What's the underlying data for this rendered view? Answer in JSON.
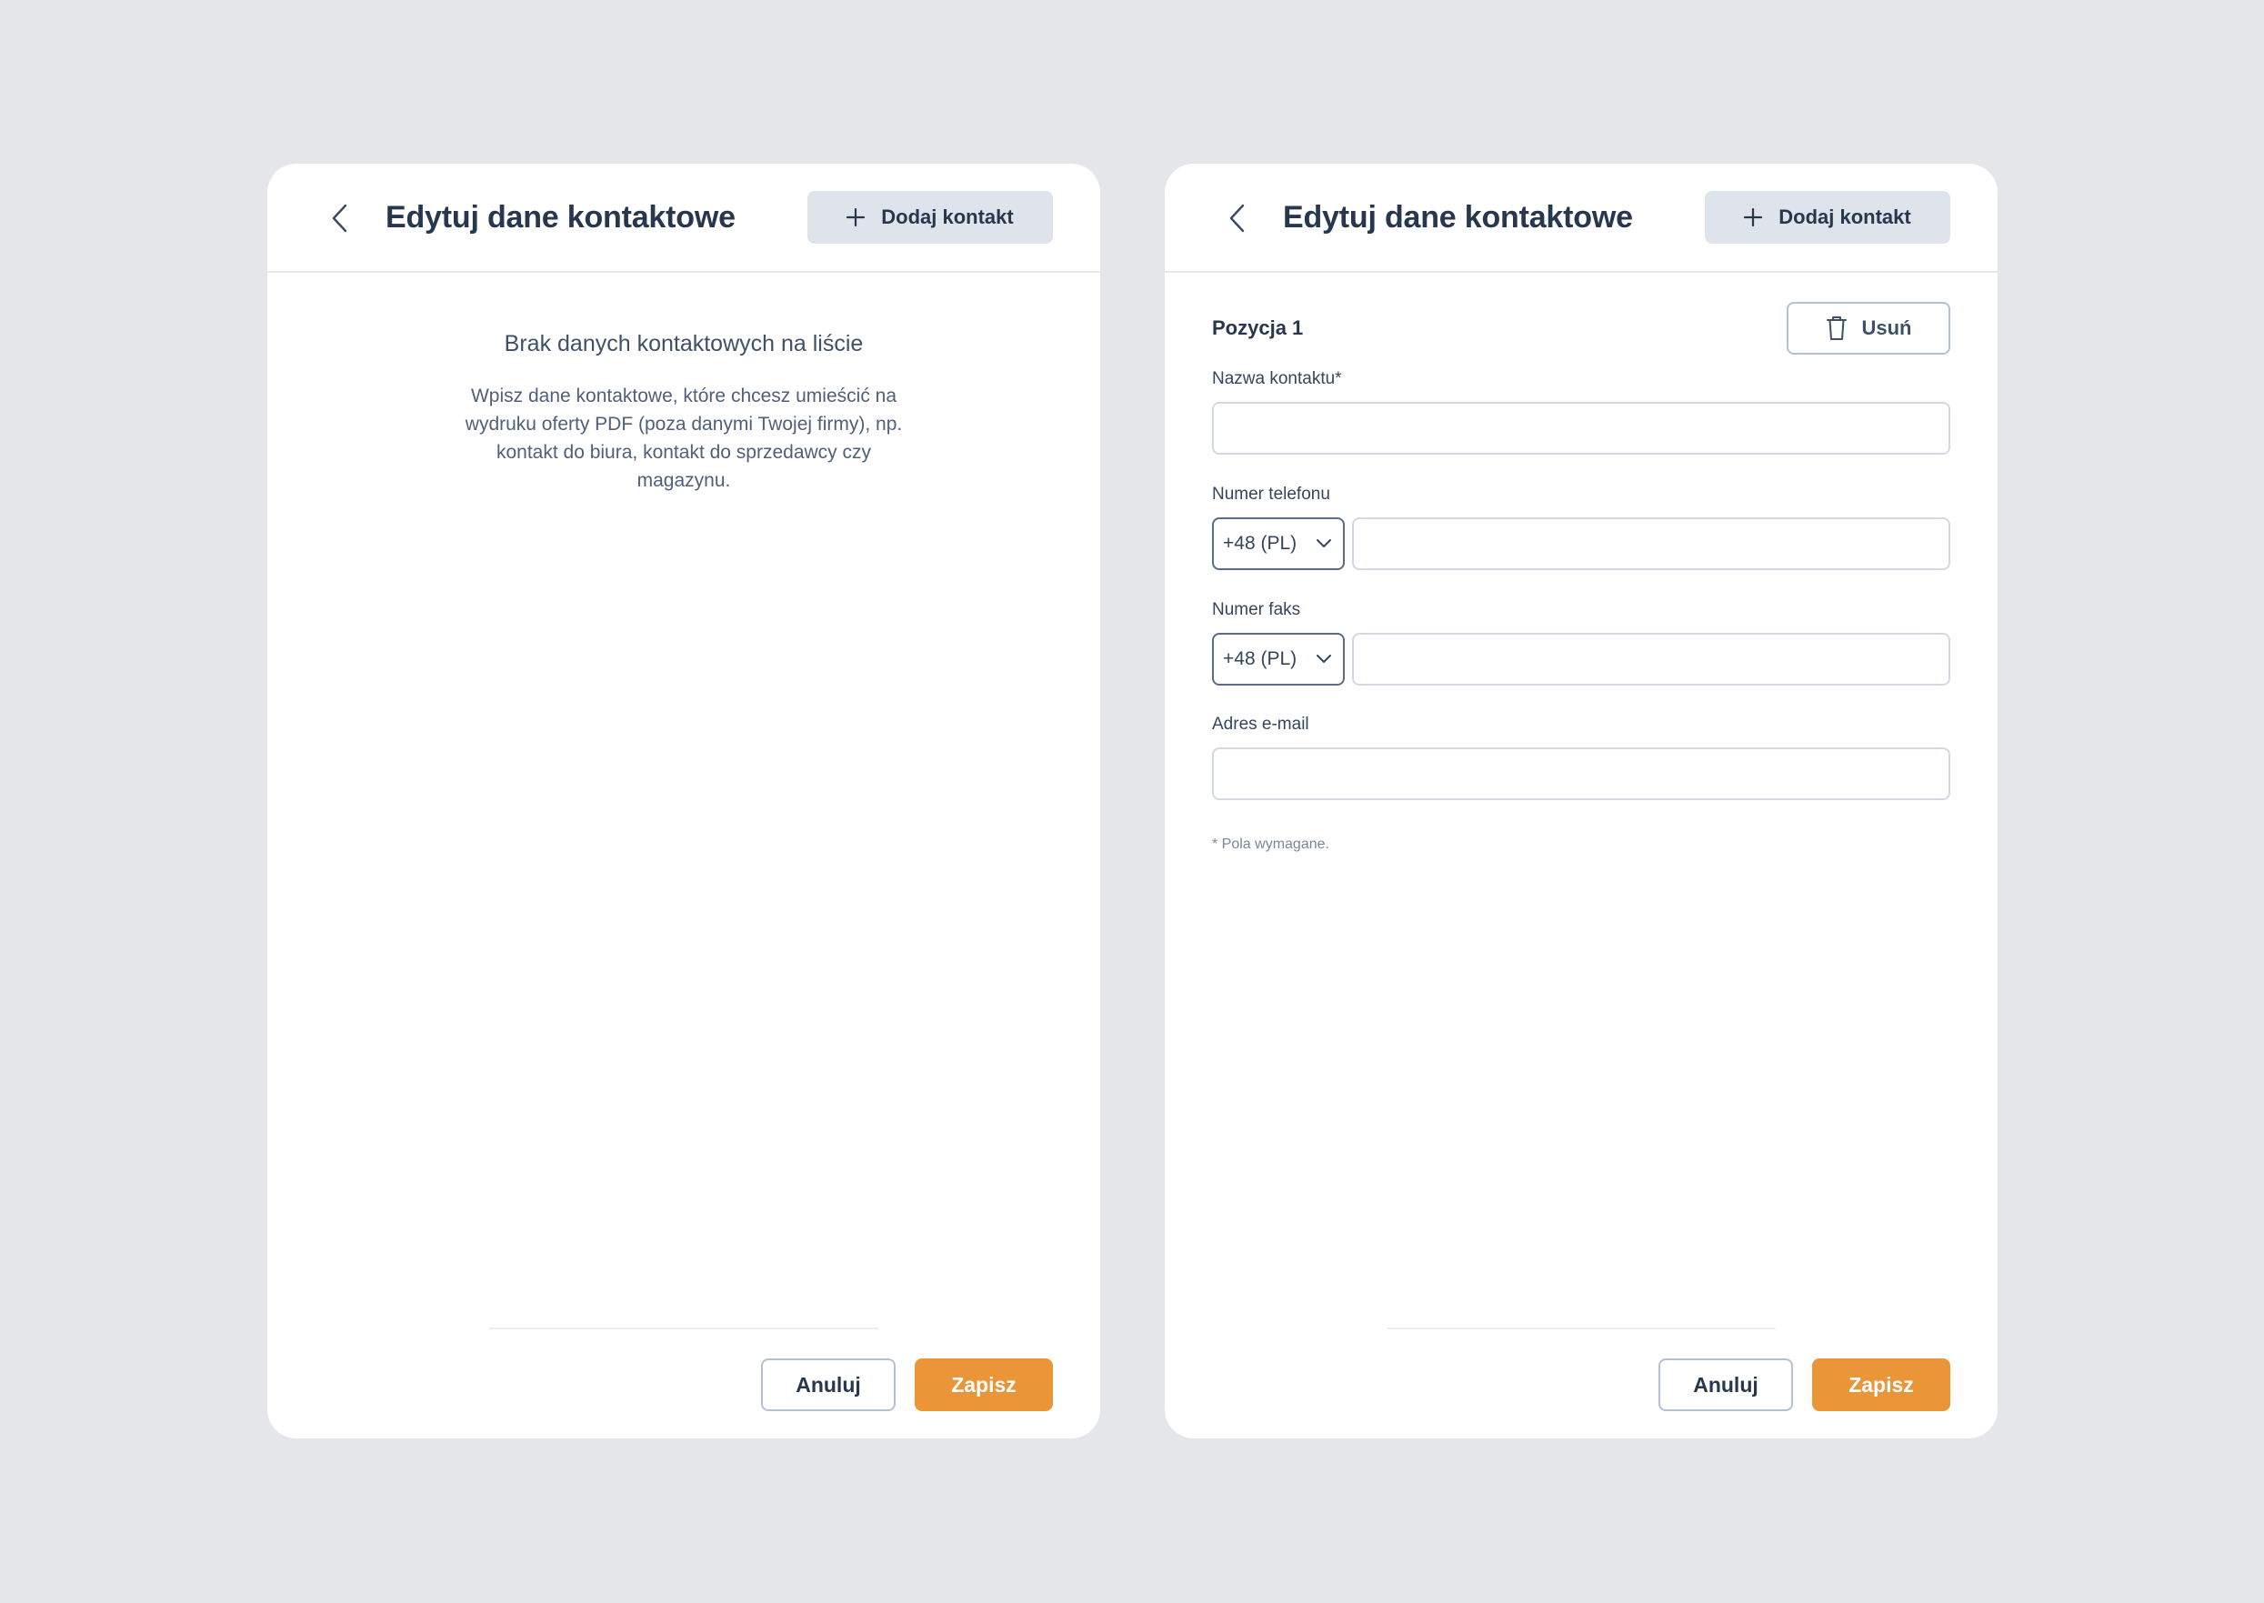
{
  "left_panel": {
    "title": "Edytuj dane kontaktowe",
    "add_button": "Dodaj kontakt",
    "empty_title": "Brak danych kontaktowych na liście",
    "empty_description": "Wpisz dane kontaktowe, które chcesz umieścić na wydruku oferty PDF (poza danymi Twojej firmy), np. kontakt do biura, kontakt do sprzedawcy czy magazynu.",
    "cancel_button": "Anuluj",
    "save_button": "Zapisz"
  },
  "right_panel": {
    "title": "Edytuj dane kontaktowe",
    "add_button": "Dodaj kontakt",
    "position_label": "Pozycja 1",
    "delete_button": "Usuń",
    "contact_name_label": "Nazwa kontaktu*",
    "contact_name_value": "",
    "phone_label": "Numer telefonu",
    "phone_prefix": "+48 (PL)",
    "phone_value": "",
    "fax_label": "Numer faks",
    "fax_prefix": "+48 (PL)",
    "fax_value": "",
    "email_label": "Adres e-mail",
    "email_value": "",
    "required_note": "* Pola wymagane.",
    "cancel_button": "Anuluj",
    "save_button": "Zapisz"
  },
  "icons": {
    "back": "chevron-left-icon",
    "add": "plus-icon",
    "delete": "trash-icon",
    "dropdown": "chevron-down-icon"
  },
  "colors": {
    "background": "#e4e6ea",
    "card": "#ffffff",
    "primary": "#ea9537",
    "secondary_button": "#dfe4ec",
    "text": "#27374d"
  }
}
